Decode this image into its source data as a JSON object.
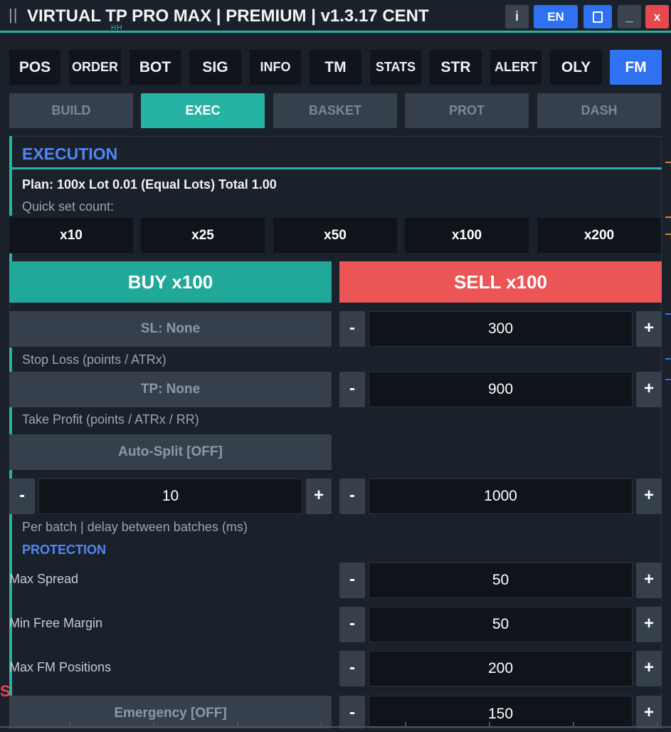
{
  "window": {
    "grip": "||",
    "title": "VIRTUAL TP PRO MAX | PREMIUM | v1.3.17  CENT",
    "title_sub": "HH",
    "buttons": {
      "info": "i",
      "lang": "EN",
      "minimize": "_",
      "close": "x"
    }
  },
  "tabs": [
    "POS",
    "ORDER",
    "BOT",
    "SIG",
    "INFO",
    "TM",
    "STATS",
    "STR",
    "ALERT",
    "OLY",
    "FM"
  ],
  "active_tab": "FM",
  "subtabs": [
    "BUILD",
    "EXEC",
    "BASKET",
    "PROT",
    "DASH"
  ],
  "active_subtab": "EXEC",
  "execution": {
    "title": "EXECUTION",
    "plan": "Plan: 100x  Lot 0.01 (Equal Lots)  Total 1.00",
    "quick_label": "Quick set count:",
    "quick": [
      "x10",
      "x25",
      "x50",
      "x100",
      "x200"
    ],
    "buy": "BUY x100",
    "sell": "SELL x100",
    "sl": {
      "toggle": "SL: None",
      "value": "300",
      "caption": "Stop Loss (points / ATRx)"
    },
    "tp": {
      "toggle": "TP: None",
      "value": "900",
      "caption": "Take Profit (points / ATRx / RR)"
    },
    "autosplit": "Auto-Split  [OFF]",
    "per_batch": "10",
    "delay": "1000",
    "batch_caption": "Per batch  |  delay between batches (ms)",
    "minus": "-",
    "plus": "+"
  },
  "protection": {
    "title": "PROTECTION",
    "max_spread": {
      "label": "Max Spread",
      "value": "50"
    },
    "min_free_margin": {
      "label": "Min Free Margin",
      "value": "50"
    },
    "max_fm_positions": {
      "label": "Max FM Positions",
      "value": "200"
    },
    "emergency": {
      "label": "Emergency  [OFF]",
      "value": "150"
    },
    "edge_mark": "S"
  },
  "colors": {
    "accent_teal": "#26b3a3",
    "accent_blue": "#2f72f1",
    "buy": "#20a898",
    "sell": "#ec5555",
    "background": "#1b212a"
  }
}
